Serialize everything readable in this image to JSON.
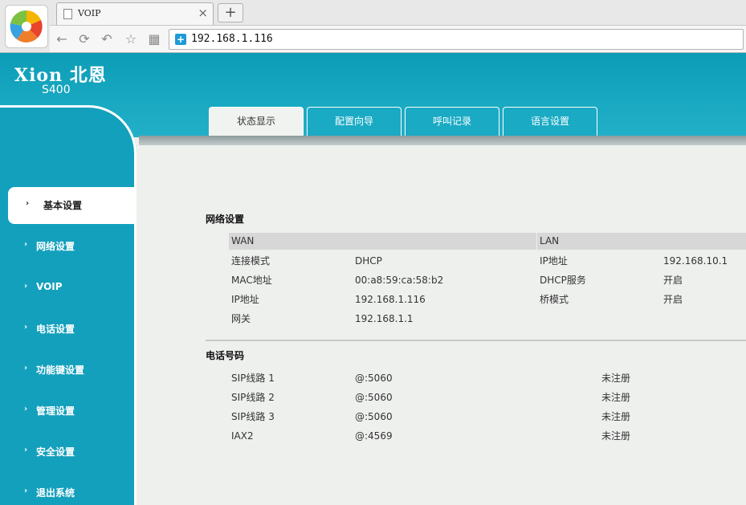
{
  "browser": {
    "tab_title": "VOIP",
    "tab_close": "×",
    "new_tab": "+",
    "url": "192.168.1.116"
  },
  "header": {
    "brand": "Xion 北恩",
    "model": "S400"
  },
  "top_tabs": [
    {
      "label": "状态显示",
      "selected": true
    },
    {
      "label": "配置向导",
      "selected": false
    },
    {
      "label": "呼叫记录",
      "selected": false
    },
    {
      "label": "语言设置",
      "selected": false
    }
  ],
  "sidebar": {
    "items": [
      {
        "label": "基本设置",
        "active": true
      },
      {
        "label": "网络设置",
        "active": false
      },
      {
        "label": "VOIP",
        "active": false
      },
      {
        "label": "电话设置",
        "active": false
      },
      {
        "label": "功能键设置",
        "active": false
      },
      {
        "label": "管理设置",
        "active": false
      },
      {
        "label": "安全设置",
        "active": false
      },
      {
        "label": "退出系统",
        "active": false
      }
    ]
  },
  "network": {
    "title": "网络设置",
    "wan_header": "WAN",
    "lan_header": "LAN",
    "wan_rows": [
      {
        "label": "连接模式",
        "value": "DHCP"
      },
      {
        "label": "MAC地址",
        "value": "00:a8:59:ca:58:b2"
      },
      {
        "label": "IP地址",
        "value": "192.168.1.116"
      },
      {
        "label": "网关",
        "value": "192.168.1.1"
      }
    ],
    "lan_rows": [
      {
        "label": "IP地址",
        "value": "192.168.10.1"
      },
      {
        "label": "DHCP服务",
        "value": "开启"
      },
      {
        "label": "桥模式",
        "value": "开启"
      }
    ]
  },
  "phone": {
    "title": "电话号码",
    "rows": [
      {
        "line": "SIP线路 1",
        "account": "@:5060",
        "status": "未注册"
      },
      {
        "line": "SIP线路 2",
        "account": "@:5060",
        "status": "未注册"
      },
      {
        "line": "SIP线路 3",
        "account": "@:5060",
        "status": "未注册"
      },
      {
        "line": "IAX2",
        "account": "@:4569",
        "status": "未注册"
      }
    ]
  }
}
